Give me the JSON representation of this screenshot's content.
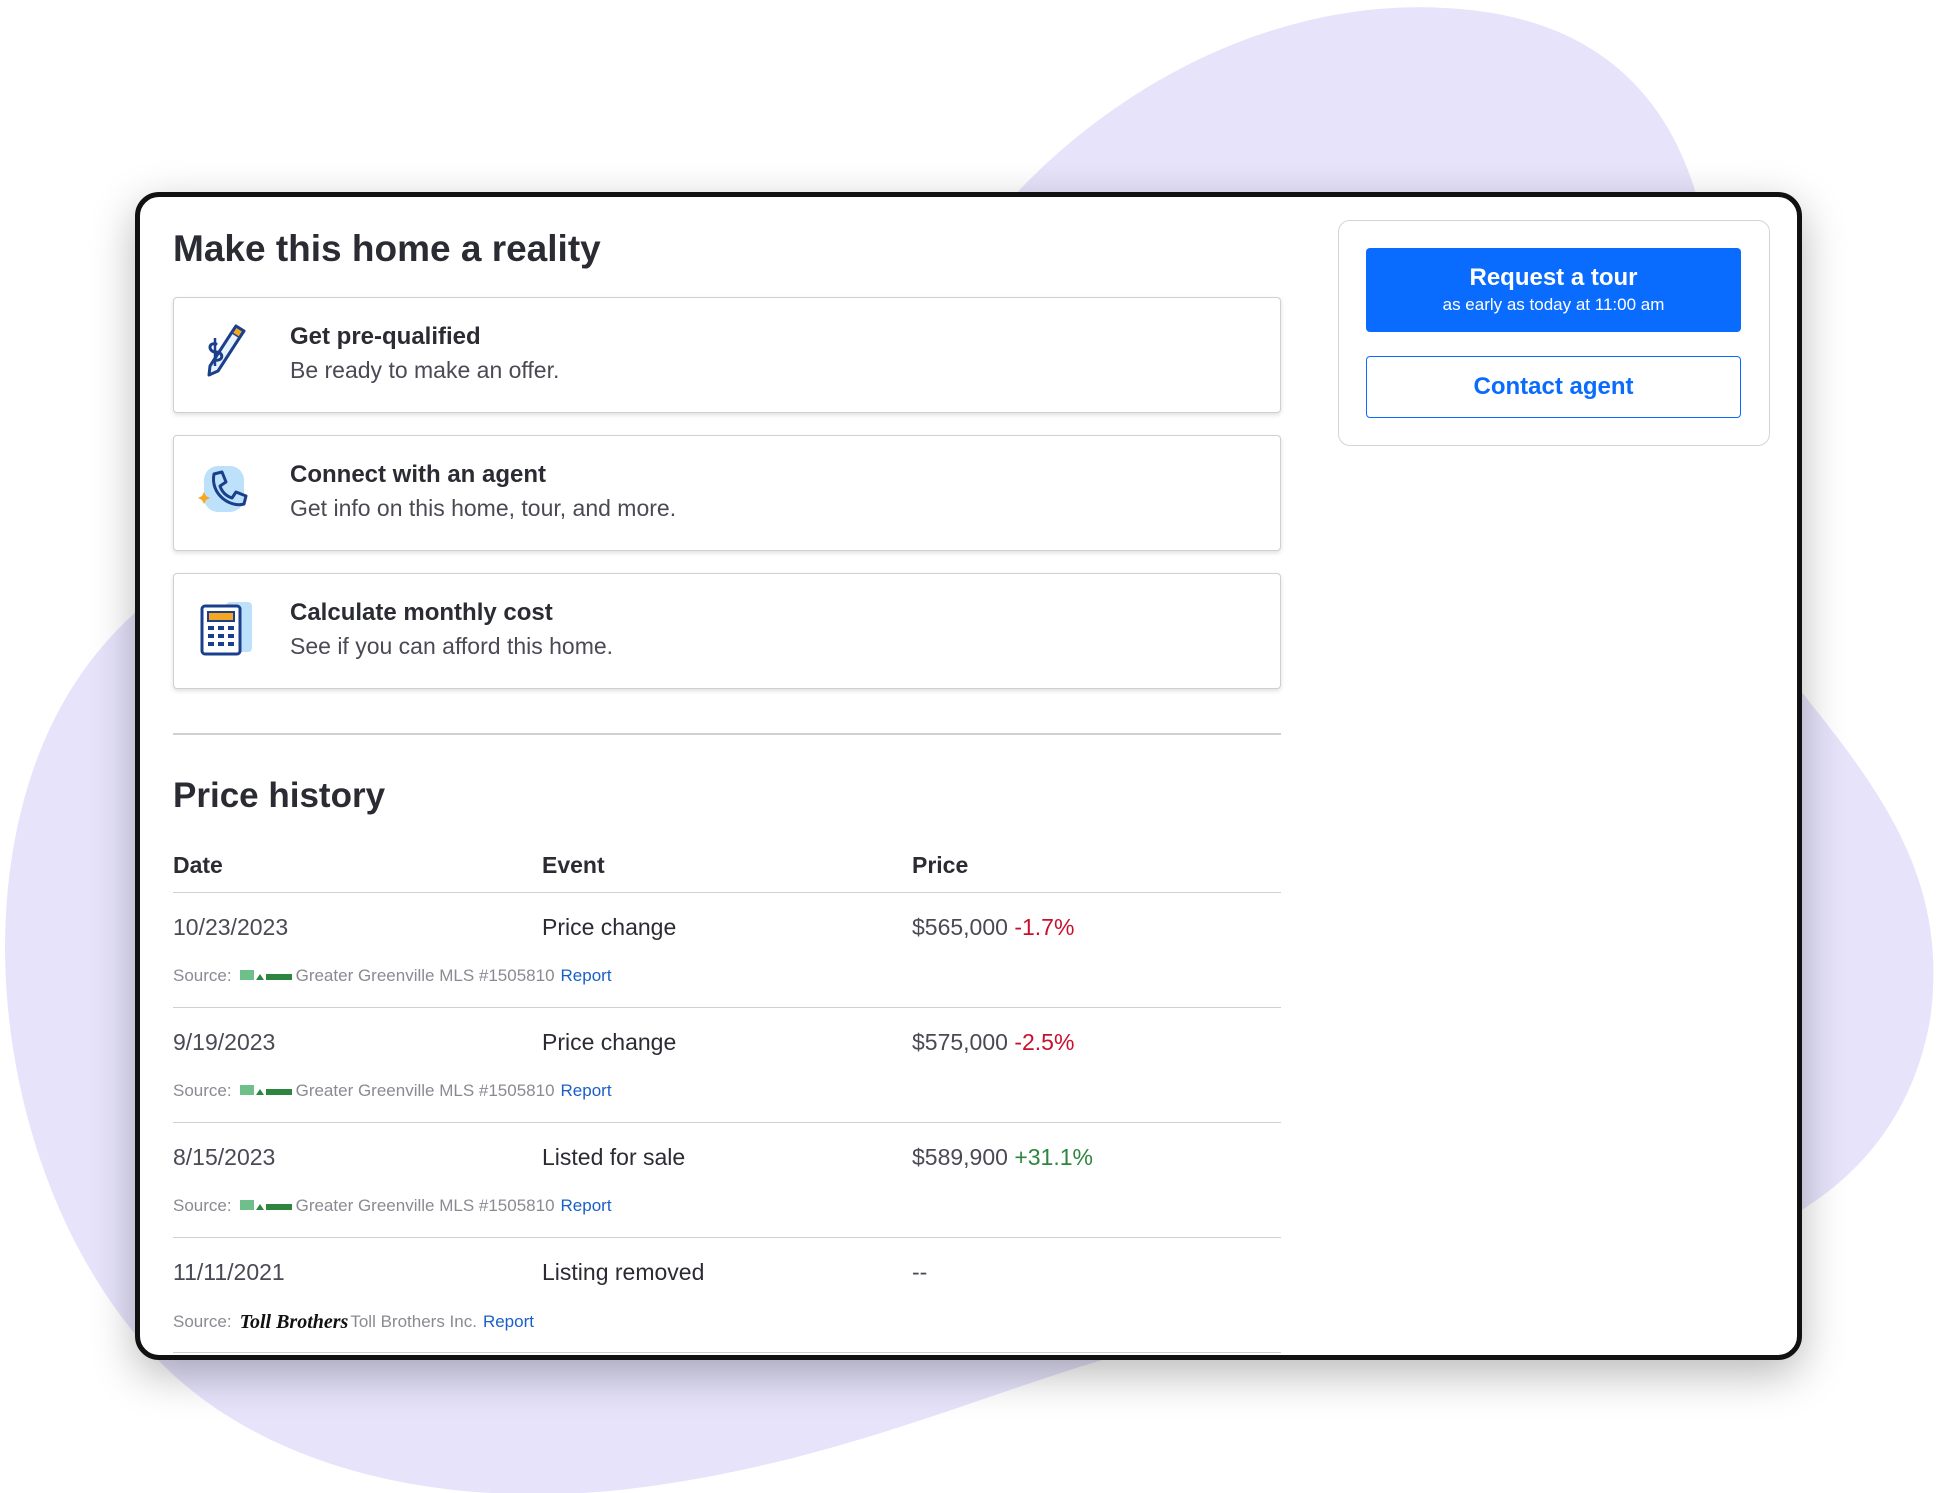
{
  "colors": {
    "accent": "#0a6cff",
    "negative": "#c8102e",
    "positive": "#2e8540",
    "blob": "#e6e3fb"
  },
  "section1": {
    "title": "Make this home a reality",
    "cards": [
      {
        "icon": "pencil-dollar-icon",
        "title": "Get pre-qualified",
        "subtitle": "Be ready to make an offer."
      },
      {
        "icon": "phone-icon",
        "title": "Connect with an agent",
        "subtitle": "Get info on this home, tour, and more."
      },
      {
        "icon": "calculator-icon",
        "title": "Calculate monthly cost",
        "subtitle": "See if you can afford this home."
      }
    ]
  },
  "price_history": {
    "title": "Price history",
    "columns": [
      "Date",
      "Event",
      "Price"
    ],
    "rows": [
      {
        "date": "10/23/2023",
        "event": "Price change",
        "price": "$565,000",
        "change": "-1.7%",
        "source_label": "Source:",
        "source": "Greater Greenville MLS #1505810",
        "report": "Report"
      },
      {
        "date": "9/19/2023",
        "event": "Price change",
        "price": "$575,000",
        "change": "-2.5%",
        "source_label": "Source:",
        "source": "Greater Greenville MLS #1505810",
        "report": "Report"
      },
      {
        "date": "8/15/2023",
        "event": "Listed for sale",
        "price": "$589,900",
        "change": "+31.1%",
        "source_label": "Source:",
        "source": "Greater Greenville MLS #1505810",
        "report": "Report"
      },
      {
        "date": "11/11/2021",
        "event": "Listing removed",
        "price": "--",
        "change": "",
        "source_label": "Source:",
        "source_logo_text": "Toll Brothers",
        "source": "Toll Brothers Inc.",
        "report": "Report"
      }
    ]
  },
  "sidebar": {
    "tour_label": "Request a tour",
    "tour_sub": "as early as today at 11:00 am",
    "contact_label": "Contact agent"
  }
}
